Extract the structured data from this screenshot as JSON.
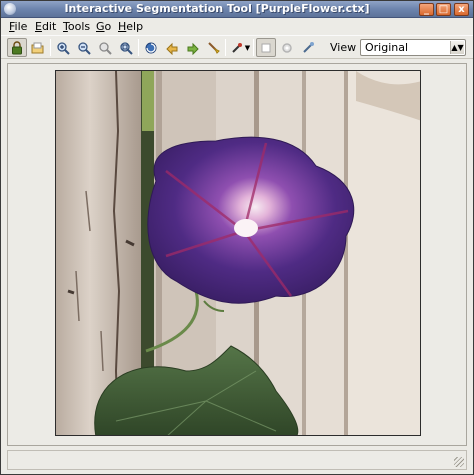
{
  "window": {
    "title": "Interactive Segmentation Tool [PurpleFlower.ctx]",
    "controls": {
      "minimize": "_",
      "maximize": "□",
      "close": "x"
    }
  },
  "menu": [
    "File",
    "Edit",
    "Tools",
    "Go",
    "Help"
  ],
  "toolbar": {
    "icons": [
      "lock-icon",
      "open-folder-icon",
      "zoom-in-icon",
      "zoom-out-icon",
      "zoom-fit-icon",
      "zoom-actual-icon",
      "refresh-icon",
      "hand-back-icon",
      "hand-forward-icon",
      "paint-brush-icon",
      "brush-dropdown-icon",
      "select-tool-icon",
      "gear-icon",
      "eyedropper-icon"
    ],
    "view_label": "View :",
    "view_select": {
      "selected": "Original"
    }
  },
  "colors": {
    "titlebar": "#6d84ad",
    "petal": "#4a2a7a",
    "fence": "#d9d1c7",
    "leaf": "#3f5a33"
  }
}
